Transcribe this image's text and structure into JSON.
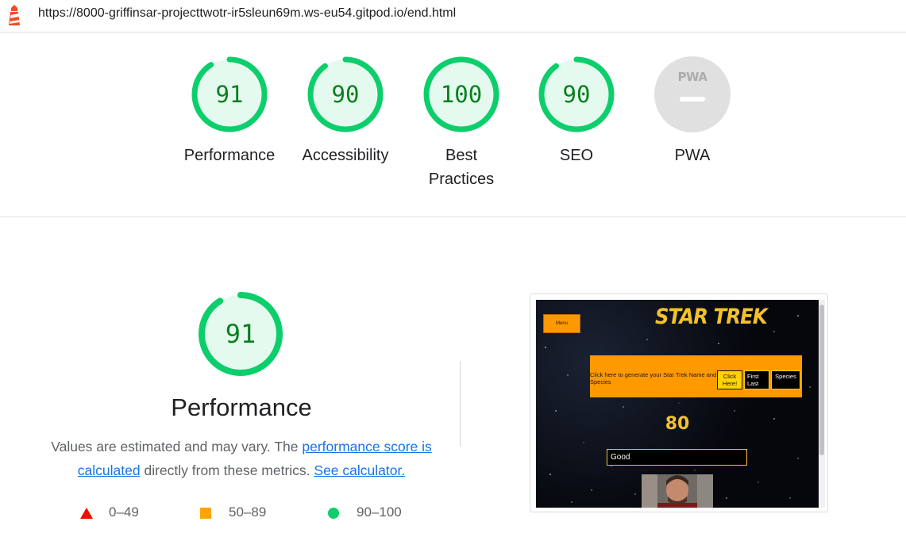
{
  "address_bar": {
    "url": "https://8000-griffinsar-projecttwotr-ir5sleun69m.ws-eu54.gitpod.io/end.html"
  },
  "colors": {
    "pass": "#0cce6b",
    "pass_text": "#0a7f1e",
    "pass_fill": "#e5faef",
    "average": "#ffa400",
    "fail": "#eb0f00",
    "link": "#1a73e8"
  },
  "gauges": [
    {
      "label": "Performance",
      "score": "91",
      "fraction": 0.91
    },
    {
      "label": "Accessibility",
      "score": "90",
      "fraction": 0.9
    },
    {
      "label": "Best Practices",
      "score": "100",
      "fraction": 1.0
    },
    {
      "label": "SEO",
      "score": "90",
      "fraction": 0.9
    },
    {
      "label": "PWA",
      "badge_text": "PWA"
    }
  ],
  "performance": {
    "score": "91",
    "fraction": 0.91,
    "title": "Performance",
    "desc_start": "Values are estimated and may vary. The ",
    "desc_link": "performance score is calculated",
    "desc_middle": " directly from these metrics. ",
    "desc_calc_link": "See calculator."
  },
  "legend": [
    {
      "icon": "red-triangle",
      "range": "0–49"
    },
    {
      "icon": "orange-square",
      "range": "50–89"
    },
    {
      "icon": "green-circle",
      "range": "90–100"
    }
  ],
  "screenshot": {
    "menu_label": "Menu",
    "logo_text": "STAR TREK",
    "prompt": "Click here to generate your Star Trek Name and Species",
    "button_label_1": "Click",
    "button_label_2": "Here!",
    "name_first": "First",
    "name_last": "Last",
    "species_label": "Species",
    "score": "80",
    "result": "Good"
  }
}
